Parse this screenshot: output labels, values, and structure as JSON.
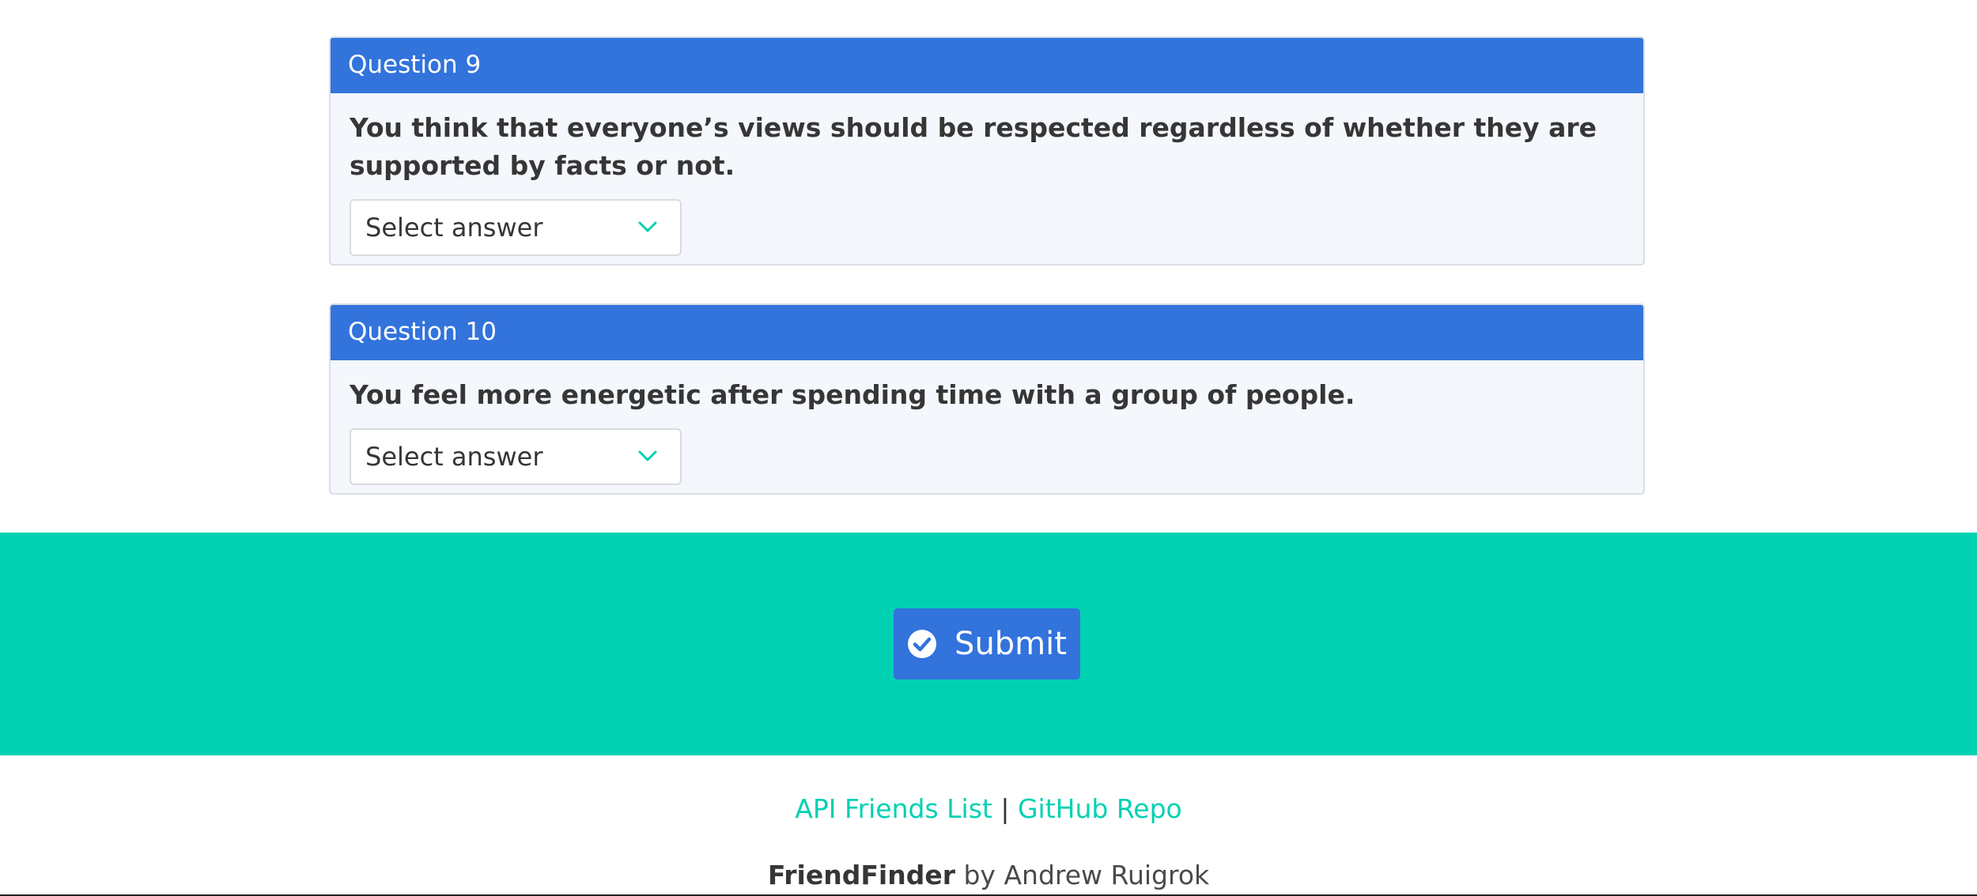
{
  "questions": [
    {
      "header": "Question 9",
      "text": "You think that everyone’s views should be respected regardless of whether they are supported by facts or not.",
      "select_value": "Select answer"
    },
    {
      "header": "Question 10",
      "text": "You feel more energetic after spending time with a group of people.",
      "select_value": "Select answer"
    }
  ],
  "submit": {
    "label": "Submit",
    "icon": "check-circle-icon"
  },
  "footer": {
    "link_api": "API Friends List",
    "separator": "|",
    "link_github": "GitHub Repo",
    "brand": "FriendFinder",
    "byline": "by Andrew Ruigrok"
  },
  "colors": {
    "primary": "#3273dc",
    "accent": "#00d1b2",
    "card_background": "#f4f7fc"
  }
}
